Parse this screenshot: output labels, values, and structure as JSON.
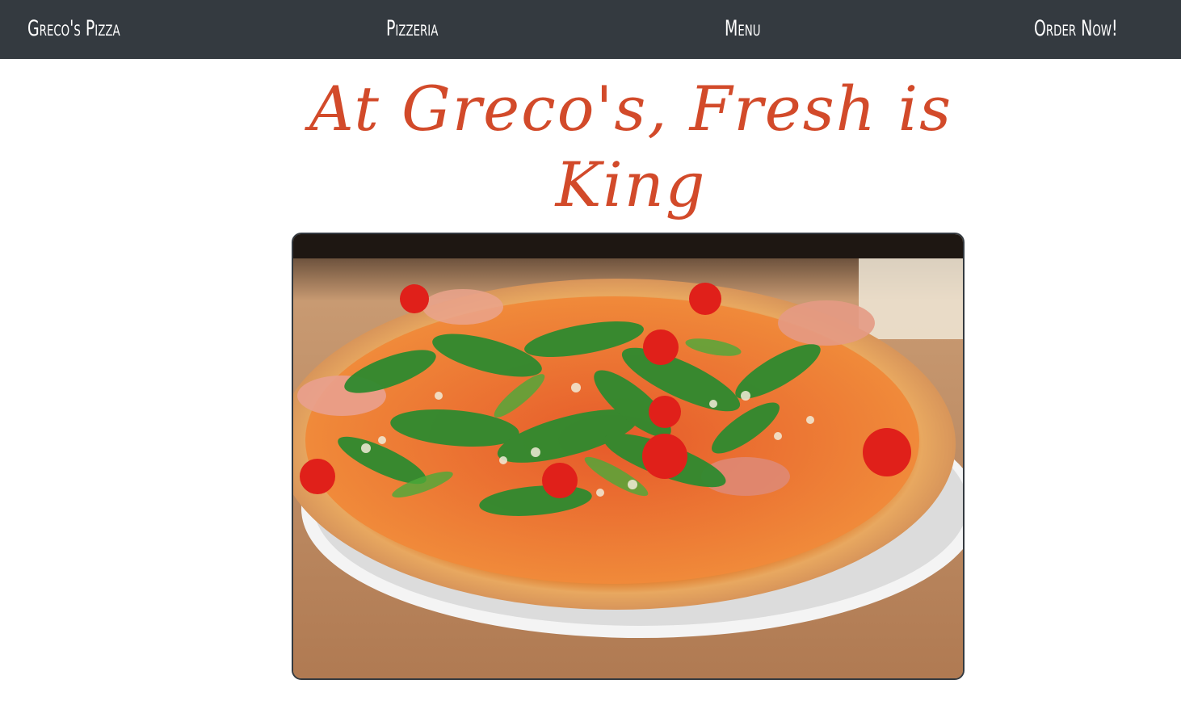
{
  "nav": {
    "brand": "Greco's Pizza",
    "links": [
      {
        "label": "Pizzeria"
      },
      {
        "label": "Menu"
      },
      {
        "label": "Order Now!"
      }
    ],
    "background": "#343a40"
  },
  "hero": {
    "headline": "At Greco's, Fresh is King",
    "headline_color": "#d24a2a"
  }
}
